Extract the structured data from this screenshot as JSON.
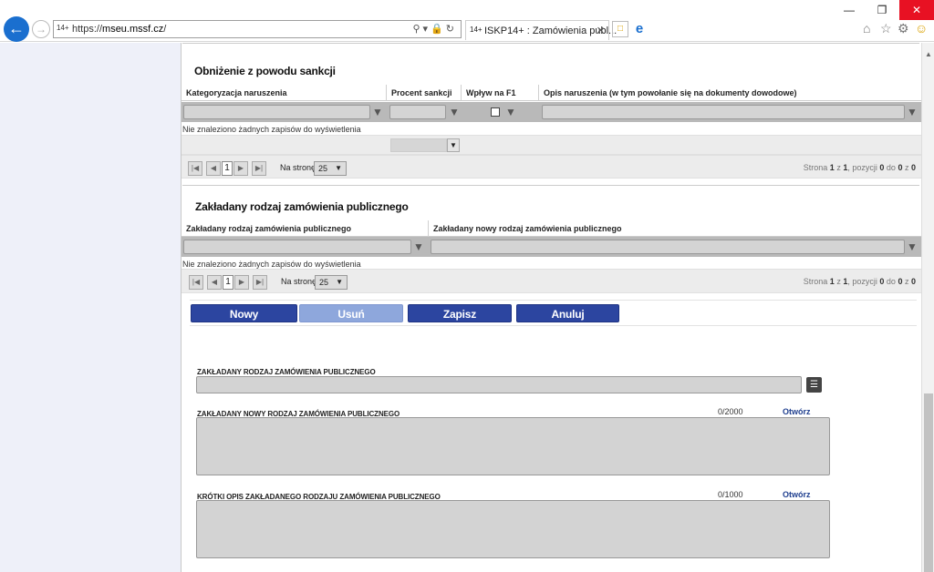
{
  "browser": {
    "url_host": "mseu.mssf.cz",
    "url_prefix": "https://",
    "url_suffix": "/",
    "tab_title": "ISKP14+ : Zamówienia publ...",
    "favicon_text": "14+"
  },
  "section1": {
    "title": "Obniżenie z powodu sankcji",
    "columns": [
      "Kategoryzacja naruszenia",
      "Procent sankcji",
      "Wpływ na F1",
      "Opis naruszenia (w tym powołanie się na dokumenty dowodowe)"
    ],
    "empty_text": "Nie znaleziono żadnych zapisów do wyświetlenia",
    "pager": {
      "page": "1",
      "per_page_label": "Na stronę",
      "per_page": "25",
      "info_prefix": "Strona",
      "page_num": "1",
      "of_label": "z",
      "page_total": "1",
      "items_label": ", pozycji",
      "from": "0",
      "to_label": "do",
      "to": "0",
      "of2_label": "z",
      "total": "0"
    }
  },
  "section2": {
    "title": "Zakładany rodzaj zamówienia publicznego",
    "columns": [
      "Zakładany rodzaj zamówienia publicznego",
      "Zakładany nowy rodzaj zamówienia publicznego"
    ],
    "empty_text": "Nie znaleziono żadnych zapisów do wyświetlenia",
    "pager": {
      "page": "1",
      "per_page_label": "Na stronę",
      "per_page": "25",
      "info_prefix": "Strona",
      "page_num": "1",
      "of_label": "z",
      "page_total": "1",
      "items_label": ", pozycji",
      "from": "0",
      "to_label": "do",
      "to": "0",
      "of2_label": "z",
      "total": "0"
    }
  },
  "buttons": {
    "new": "Nowy",
    "delete": "Usuń",
    "save": "Zapisz",
    "cancel": "Anuluj"
  },
  "form": {
    "field1_label": "ZAKŁADANY RODZAJ ZAMÓWIENIA PUBLICZNEGO",
    "field2_label": "ZAKŁADANY NOWY RODZAJ ZAMÓWIENIA PUBLICZNEGO",
    "field2_counter": "0/2000",
    "field2_open": "Otwórz",
    "field3_label": "KRÓTKI OPIS ZAKŁADANEGO RODZAJU ZAMÓWIENIA PUBLICZNEGO",
    "field3_counter": "0/1000",
    "field3_open": "Otwórz"
  },
  "colors": {
    "primary_button": "#2c45a0",
    "disabled_button": "#8ea7dc",
    "link": "#1f3f8f",
    "sidebar": "#eef0f9"
  }
}
